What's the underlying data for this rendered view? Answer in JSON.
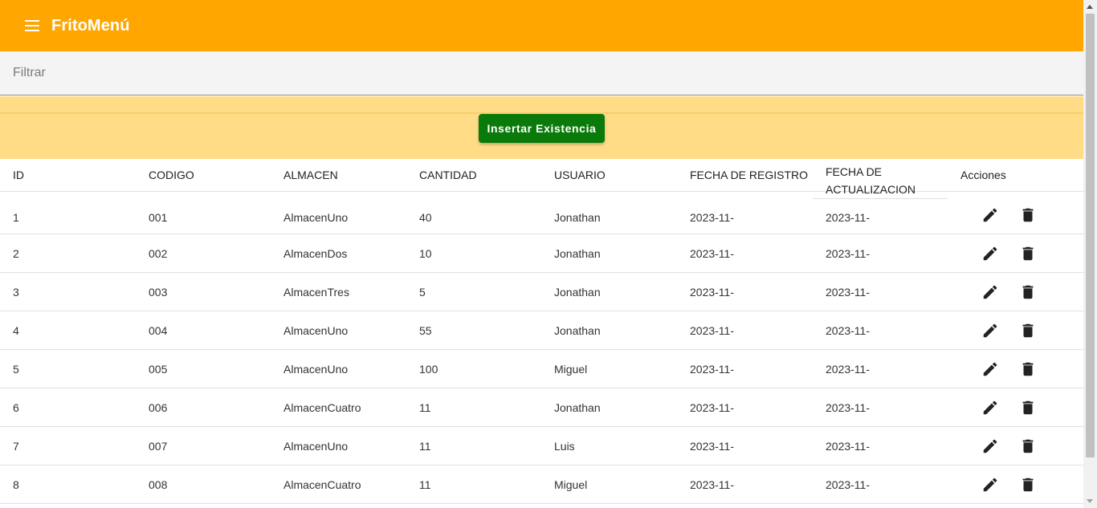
{
  "app": {
    "title": "FritoMenú"
  },
  "filter": {
    "placeholder": "Filtrar"
  },
  "actions": {
    "insert_label": "Insertar Existencia"
  },
  "table": {
    "headers": {
      "id": "ID",
      "codigo": "CODIGO",
      "almacen": "ALMACEN",
      "cantidad": "CANTIDAD",
      "usuario": "USUARIO",
      "fecha_registro": "FECHA DE REGISTRO",
      "fecha_actualizacion_1": "FECHA DE",
      "fecha_actualizacion_2": "ACTUALIZACION",
      "acciones": "Acciones"
    },
    "rows": [
      {
        "id": "1",
        "codigo": "001",
        "almacen": "AlmacenUno",
        "cantidad": "40",
        "usuario": "Jonathan",
        "fecha_registro": "2023-11-",
        "fecha_actualizacion": "2023-11-"
      },
      {
        "id": "2",
        "codigo": "002",
        "almacen": "AlmacenDos",
        "cantidad": "10",
        "usuario": "Jonathan",
        "fecha_registro": "2023-11-",
        "fecha_actualizacion": "2023-11-"
      },
      {
        "id": "3",
        "codigo": "003",
        "almacen": "AlmacenTres",
        "cantidad": "5",
        "usuario": "Jonathan",
        "fecha_registro": "2023-11-",
        "fecha_actualizacion": "2023-11-"
      },
      {
        "id": "4",
        "codigo": "004",
        "almacen": "AlmacenUno",
        "cantidad": "55",
        "usuario": "Jonathan",
        "fecha_registro": "2023-11-",
        "fecha_actualizacion": "2023-11-"
      },
      {
        "id": "5",
        "codigo": "005",
        "almacen": "AlmacenUno",
        "cantidad": "100",
        "usuario": "Miguel",
        "fecha_registro": "2023-11-",
        "fecha_actualizacion": "2023-11-"
      },
      {
        "id": "6",
        "codigo": "006",
        "almacen": "AlmacenCuatro",
        "cantidad": "11",
        "usuario": "Jonathan",
        "fecha_registro": "2023-11-",
        "fecha_actualizacion": "2023-11-"
      },
      {
        "id": "7",
        "codigo": "007",
        "almacen": "AlmacenUno",
        "cantidad": "11",
        "usuario": "Luis",
        "fecha_registro": "2023-11-",
        "fecha_actualizacion": "2023-11-"
      },
      {
        "id": "8",
        "codigo": "008",
        "almacen": "AlmacenCuatro",
        "cantidad": "11",
        "usuario": "Miguel",
        "fecha_registro": "2023-11-",
        "fecha_actualizacion": "2023-11-"
      }
    ]
  },
  "icons": {
    "menu": "menu-icon",
    "edit": "pencil-icon",
    "delete": "trash-icon"
  },
  "colors": {
    "topbar": "#ffa600",
    "action_band": "#ffdc85",
    "insert_button": "#0a7a0a"
  }
}
